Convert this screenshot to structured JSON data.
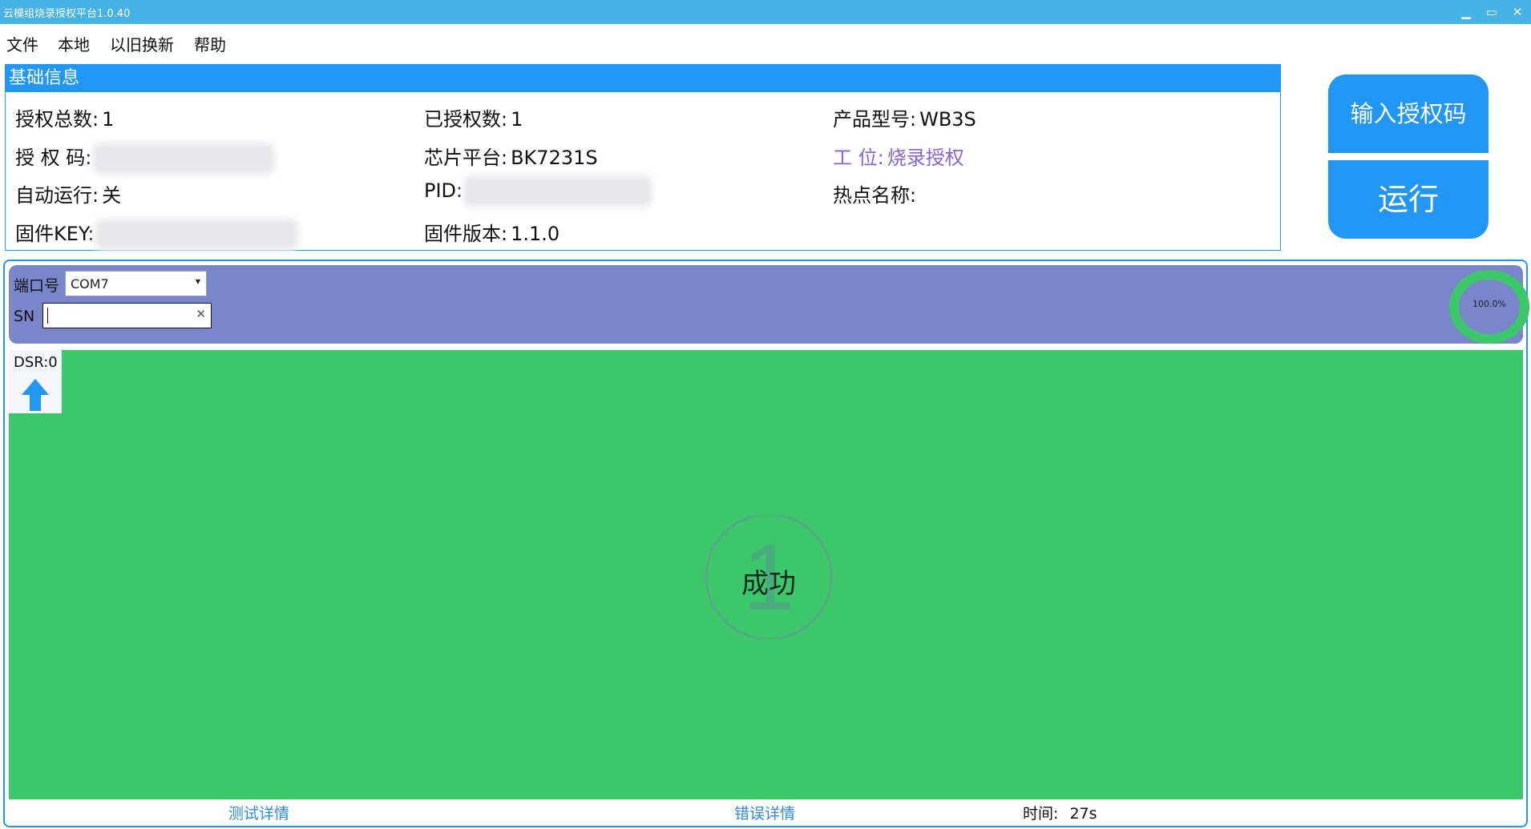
{
  "window": {
    "title": "云模组烧录授权平台1.0.40",
    "minimize": "▁",
    "restore": "▭",
    "close": "✕"
  },
  "menu": [
    "文件",
    "本地",
    "以旧换新",
    "帮助"
  ],
  "info": {
    "header": "基础信息",
    "auth_total_label": "授权总数:",
    "auth_total_value": "1",
    "authorized_label": "已授权数:",
    "authorized_value": "1",
    "model_label": "产品型号:",
    "model_value": "WB3S",
    "auth_code_label": "授 权 码:",
    "chip_label": "芯片平台:",
    "chip_value": "BK7231S",
    "station_label": "工 位:",
    "station_value": "烧录授权",
    "autorun_label": "自动运行:",
    "autorun_value": "关",
    "pid_label": "PID:",
    "hotspot_label": "热点名称:",
    "fw_key_label": "固件KEY:",
    "fw_version_label": "固件版本:",
    "fw_version_value": "1.1.0"
  },
  "buttons": {
    "enter_auth_code": "输入授权码",
    "run": "运行"
  },
  "port": {
    "port_label": "端口号",
    "port_value": "COM7",
    "sn_label": "SN",
    "sn_value": ""
  },
  "progress": {
    "fraction": 1.0,
    "text": "100.0%"
  },
  "status": {
    "dsr": "DSR:0",
    "result": "成功",
    "result_color": "#3cc76b"
  },
  "footer": {
    "test_details": "测试详情",
    "error_details": "错误详情",
    "time_label": "时间:",
    "time_value": "27s"
  },
  "colors": {
    "accent": "#2196f3",
    "titlebar": "#45b3e6",
    "port_bar": "#7986cb",
    "station": "#8a63d2"
  }
}
